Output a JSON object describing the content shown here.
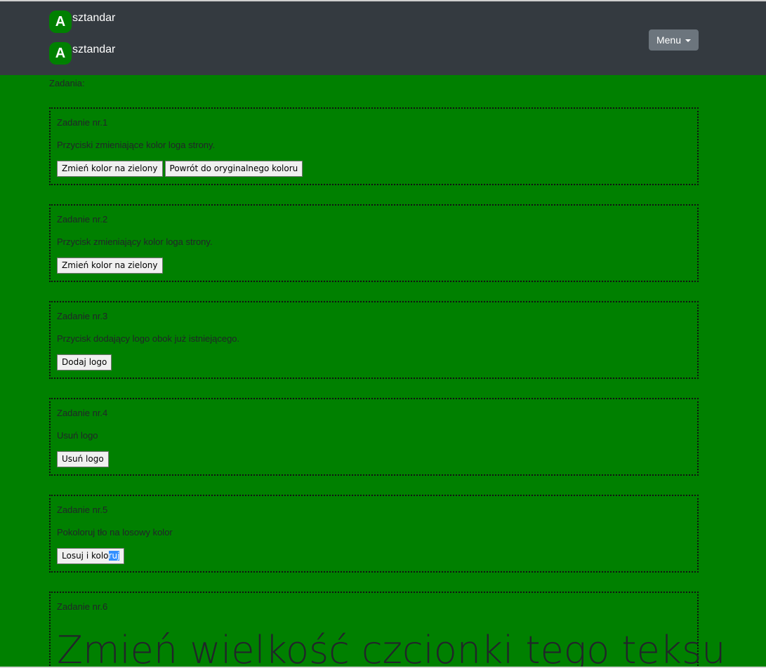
{
  "header": {
    "logo_letter": "A",
    "brand_rows": [
      "sztandar",
      "sztandar"
    ],
    "menu_label": "Menu"
  },
  "section_label": "Zadania:",
  "tasks": [
    {
      "title": "Zadanie nr.1",
      "description": "Przyciski zmieniające kolor loga strony.",
      "buttons": [
        "Zmień kolor na zielony",
        "Powrót do oryginalnego koloru"
      ]
    },
    {
      "title": "Zadanie nr.2",
      "description": "Przycisk zmieniający kolor loga strony.",
      "buttons": [
        "Zmień kolor na zielony"
      ]
    },
    {
      "title": "Zadanie nr.3",
      "description": "Przycisk dodający logo obok już istniejącego.",
      "buttons": [
        "Dodaj logo"
      ]
    },
    {
      "title": "Zadanie nr.4",
      "description": "Usuń logo",
      "buttons": [
        "Usuń logo"
      ]
    },
    {
      "title": "Zadanie nr.5",
      "description": "Pokoloruj tło na losowy kolor",
      "button_parts": [
        "Losuj i kolo",
        "ruj"
      ]
    },
    {
      "title": "Zadanie nr.6",
      "big_text": "Zmień wielkość czcionki tego teksu"
    }
  ],
  "colors": {
    "page_background": "#008000",
    "navbar": "#343a40",
    "logo_badge": "#008000",
    "menu_button": "#6c757d",
    "selection": "#3390ff"
  }
}
